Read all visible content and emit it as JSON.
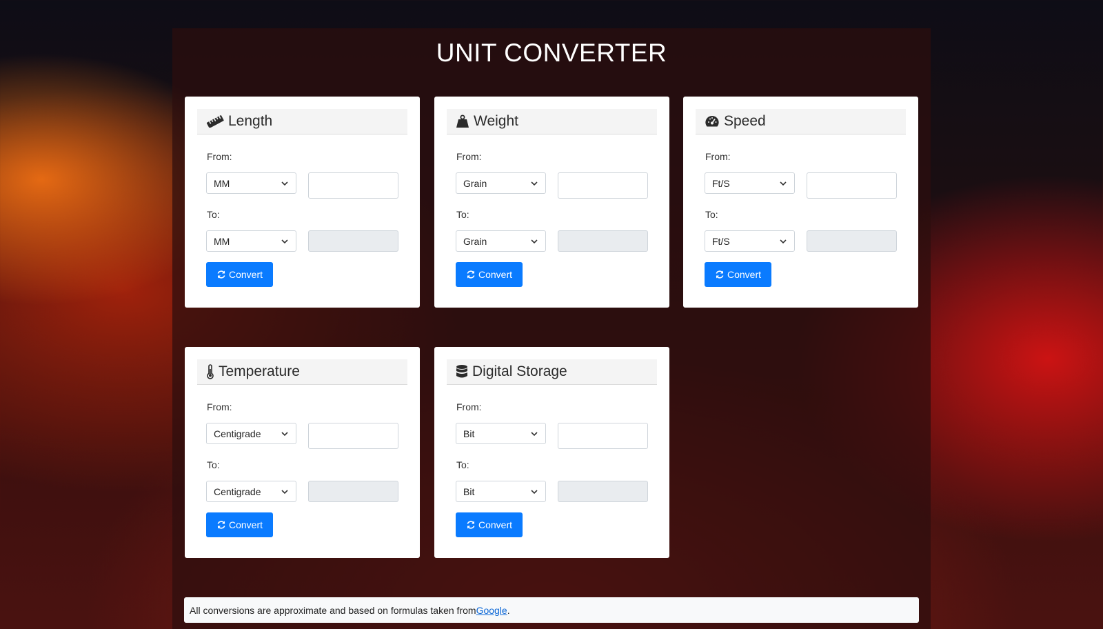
{
  "page": {
    "title": "UNIT CONVERTER"
  },
  "converters": {
    "length": {
      "title": "Length",
      "icon": "ruler-icon",
      "from_label": "From:",
      "to_label": "To:",
      "from_unit": "MM",
      "to_unit": "MM",
      "from_value": "",
      "to_value": "",
      "button": "Convert"
    },
    "weight": {
      "title": "Weight",
      "icon": "weight-icon",
      "from_label": "From:",
      "to_label": "To:",
      "from_unit": "Grain",
      "to_unit": "Grain",
      "from_value": "",
      "to_value": "",
      "button": "Convert"
    },
    "speed": {
      "title": "Speed",
      "icon": "speedometer-icon",
      "from_label": "From:",
      "to_label": "To:",
      "from_unit": "Ft/S",
      "to_unit": "Ft/S",
      "from_value": "",
      "to_value": "",
      "button": "Convert"
    },
    "temperature": {
      "title": "Temperature",
      "icon": "thermometer-icon",
      "from_label": "From:",
      "to_label": "To:",
      "from_unit": "Centigrade",
      "to_unit": "Centigrade",
      "from_value": "",
      "to_value": "",
      "button": "Convert"
    },
    "storage": {
      "title": "Digital Storage",
      "icon": "database-icon",
      "from_label": "From:",
      "to_label": "To:",
      "from_unit": "Bit",
      "to_unit": "Bit",
      "from_value": "",
      "to_value": "",
      "button": "Convert"
    }
  },
  "footer": {
    "text": "All conversions are approximate and based on formulas taken from ",
    "link": "Google",
    "suffix": "."
  },
  "colors": {
    "button": "#0a7bff",
    "link": "#0a66d6",
    "disabled_field": "#e9ecef"
  }
}
